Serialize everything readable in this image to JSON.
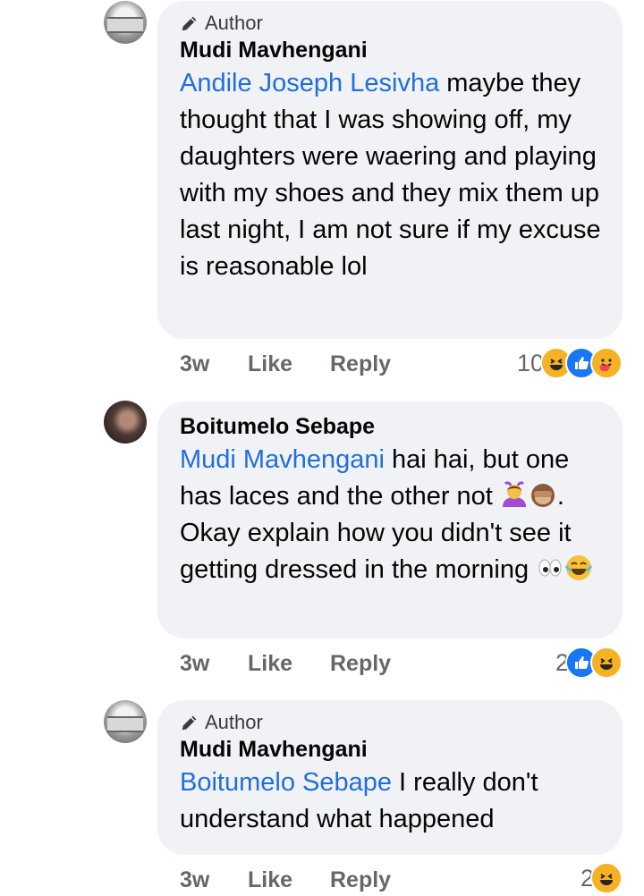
{
  "comments": [
    {
      "author_tag": "Author",
      "name": "Mudi Mavhengani",
      "mention": "Andile Joseph Lesivha",
      "text": " maybe they thought that I was showing off, my daughters were waering and playing with my shoes and they mix them up last night, I am not sure if my excuse is reasonable lol",
      "time": "3w",
      "like": "Like",
      "reply": "Reply",
      "reaction_count": "10",
      "reactions": [
        "haha-icon",
        "like-icon",
        "care-icon"
      ]
    },
    {
      "name": "Boitumelo Sebape",
      "mention": "Mudi Mavhengani",
      "text_a": " hai hai, but one has laces and the other not ",
      "text_b": ". Okay explain how you didn't see it getting dressed in the morning ",
      "emojis_a": [
        "woman-gesturing-ok-emoji",
        "see-no-evil-monkey-emoji"
      ],
      "emojis_b": [
        "eyes-emoji",
        "laughing-tears-emoji"
      ],
      "time": "3w",
      "like": "Like",
      "reply": "Reply",
      "reaction_count": "2",
      "reactions": [
        "like-icon",
        "haha-icon"
      ]
    },
    {
      "author_tag": "Author",
      "name": "Mudi Mavhengani",
      "mention": "Boitumelo Sebape",
      "text": " I really don't understand what happened",
      "time": "3w",
      "like": "Like",
      "reply": "Reply",
      "reaction_count": "2",
      "reactions": [
        "haha-icon"
      ]
    }
  ],
  "colors": {
    "bubble": "#f0f2f5",
    "mention": "#216fdb",
    "meta": "#65676b",
    "like_blue": "#1877f2",
    "haha_yellow": "#f7b125"
  }
}
